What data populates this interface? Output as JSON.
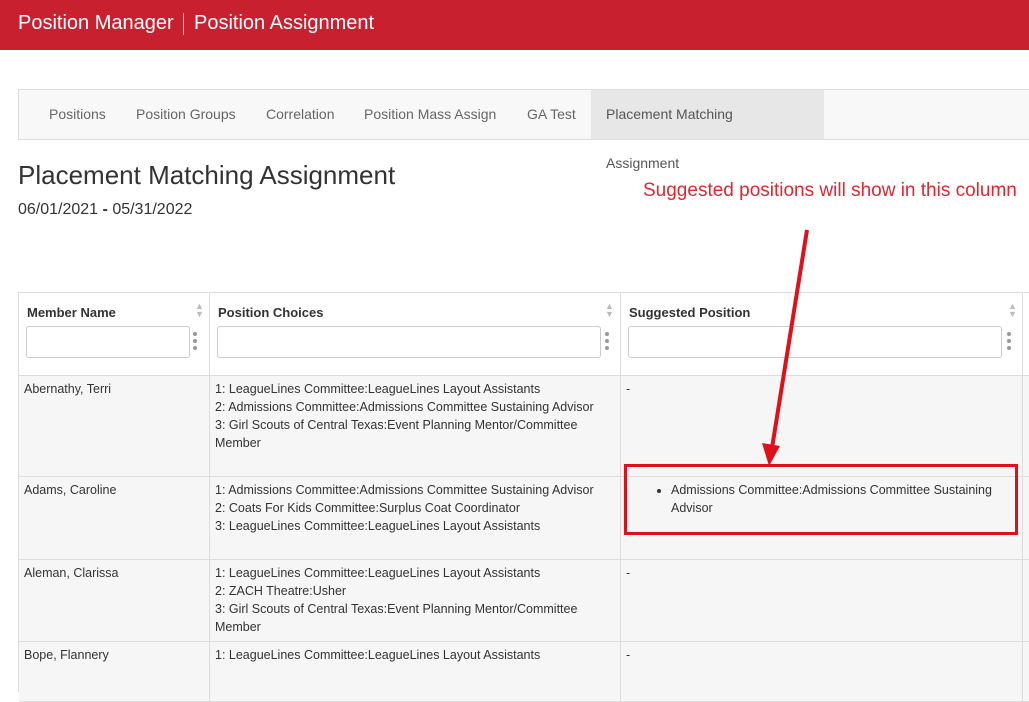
{
  "header": {
    "app_title": "Position Manager",
    "page_title": "Position Assignment"
  },
  "tabs": [
    {
      "label": "Positions"
    },
    {
      "label": "Position Groups"
    },
    {
      "label": "Correlation"
    },
    {
      "label": "Position Mass Assign"
    },
    {
      "label": "GA Test"
    },
    {
      "label": "Placement Matching Assignment",
      "active": true
    }
  ],
  "page": {
    "title": "Placement Matching Assignment",
    "date_start": "06/01/2021",
    "date_sep": "-",
    "date_end": "05/31/2022"
  },
  "annotation": {
    "text": "Suggested positions will show in this column",
    "color": "#e0262f"
  },
  "table": {
    "columns": [
      "Member Name",
      "Position Choices",
      "Suggested Position"
    ],
    "rows": [
      {
        "name": "Abernathy, Terri",
        "choices": [
          "1: LeagueLines Committee:LeagueLines Layout Assistants",
          "2: Admissions Committee:Admissions Committee Sustaining Advisor",
          "3: Girl Scouts of Central Texas:Event Planning Mentor/Committee Member"
        ],
        "suggested": "-"
      },
      {
        "name": "Adams, Caroline",
        "choices": [
          "1: Admissions Committee:Admissions Committee Sustaining Advisor",
          "2: Coats For Kids Committee:Surplus Coat Coordinator",
          "3: LeagueLines Committee:LeagueLines Layout Assistants"
        ],
        "suggested_list": [
          "Admissions Committee:Admissions Committee Sustaining Advisor"
        ]
      },
      {
        "name": "Aleman, Clarissa",
        "choices": [
          "1: LeagueLines Committee:LeagueLines Layout Assistants",
          "2: ZACH Theatre:Usher",
          "3: Girl Scouts of Central Texas:Event Planning Mentor/Committee Member"
        ],
        "suggested": "-"
      },
      {
        "name": "Bope, Flannery",
        "choices": [
          "1: LeagueLines Committee:LeagueLines Layout Assistants"
        ],
        "suggested": "-"
      }
    ]
  },
  "colors": {
    "brand": "#c8202e",
    "highlight": "#e0101a"
  }
}
